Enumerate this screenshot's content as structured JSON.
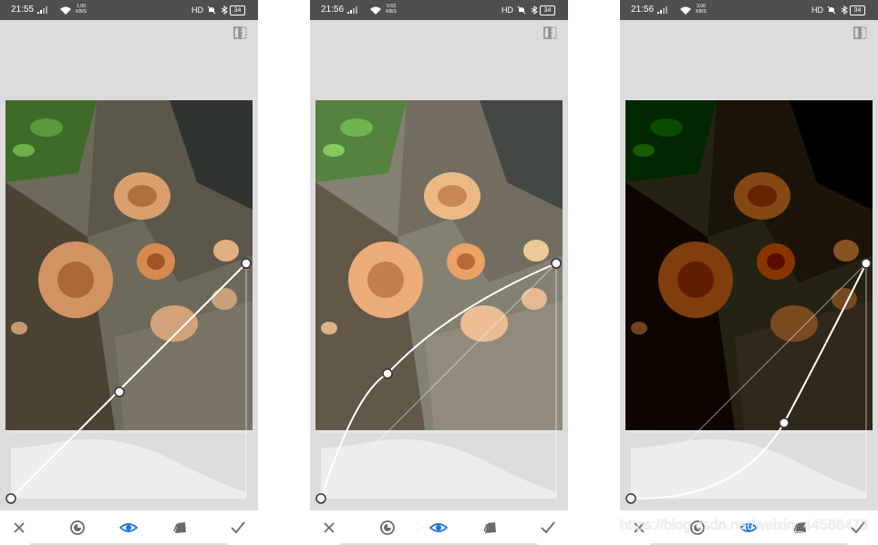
{
  "screens": [
    {
      "status": {
        "time": "21:55",
        "net_speed": "1.00 KB/S",
        "network": "HD",
        "battery": "34"
      },
      "variant": "normal",
      "active_tool": "eye"
    },
    {
      "status": {
        "time": "21:56",
        "net_speed": "0.63 KB/S",
        "network": "HD",
        "battery": "34"
      },
      "variant": "light",
      "active_tool": "eye"
    },
    {
      "status": {
        "time": "21:56",
        "net_speed": "3.00 KB/S",
        "network": "HD",
        "battery": "34"
      },
      "variant": "dark",
      "active_tool": "eye"
    }
  ],
  "toolbar": {
    "tools": [
      "close-icon",
      "tone-icon",
      "eye-icon",
      "styles-icon",
      "check-icon"
    ]
  },
  "watermark": "https://blog.csdn.net/weixin_44586473",
  "colors": {
    "status_bar": "#4f4f4f",
    "background": "#dcdcdc",
    "accent": "#1a73e8",
    "icon": "#6b6b6b"
  }
}
